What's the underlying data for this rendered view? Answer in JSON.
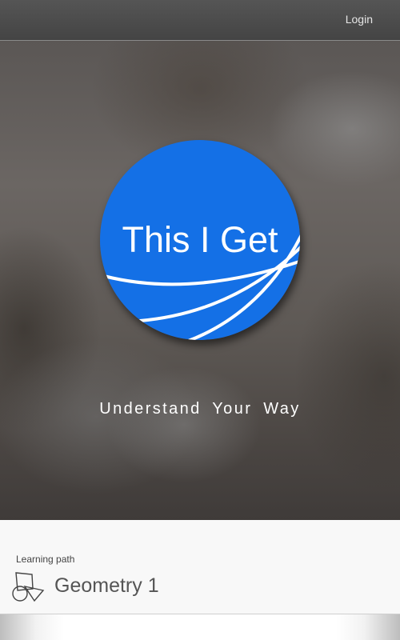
{
  "header": {
    "login_label": "Login"
  },
  "hero": {
    "logo_text": "This I Get",
    "tagline": "Understand Your Way",
    "logo_color": "#1470e6"
  },
  "learning_path": {
    "label": "Learning path",
    "title": "Geometry 1",
    "icon": "geometry-shapes-icon"
  }
}
